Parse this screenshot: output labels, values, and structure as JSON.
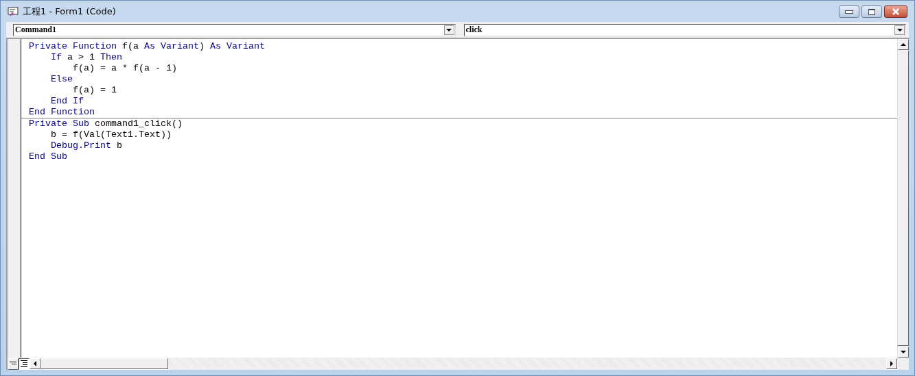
{
  "window": {
    "title": "工程1 - Form1 (Code)"
  },
  "object_dropdown": {
    "value": "Command1"
  },
  "procedure_dropdown": {
    "value": "click"
  },
  "procedures": [
    {
      "lines": [
        [
          {
            "text": "Private Function",
            "kind": "keyword"
          },
          {
            "text": " f(a ",
            "kind": "plain"
          },
          {
            "text": "As Variant",
            "kind": "keyword"
          },
          {
            "text": ") ",
            "kind": "plain"
          },
          {
            "text": "As Variant",
            "kind": "keyword"
          }
        ],
        [
          {
            "text": "    If",
            "kind": "keyword"
          },
          {
            "text": " a > 1 ",
            "kind": "plain"
          },
          {
            "text": "Then",
            "kind": "keyword"
          }
        ],
        [
          {
            "text": "        f(a) = a * f(a - 1)",
            "kind": "plain"
          }
        ],
        [
          {
            "text": "    Else",
            "kind": "keyword"
          }
        ],
        [
          {
            "text": "        f(a) = 1",
            "kind": "plain"
          }
        ],
        [
          {
            "text": "    End If",
            "kind": "keyword"
          }
        ],
        [
          {
            "text": "End Function",
            "kind": "keyword"
          }
        ]
      ]
    },
    {
      "lines": [
        [
          {
            "text": "Private Sub",
            "kind": "keyword"
          },
          {
            "text": " command1_click()",
            "kind": "plain"
          }
        ],
        [
          {
            "text": "    b = f(Val(Text1.Text))",
            "kind": "plain"
          }
        ],
        [
          {
            "text": "    Debug.Print",
            "kind": "keyword"
          },
          {
            "text": " b",
            "kind": "plain"
          }
        ],
        [
          {
            "text": "End Sub",
            "kind": "keyword"
          }
        ]
      ]
    }
  ]
}
